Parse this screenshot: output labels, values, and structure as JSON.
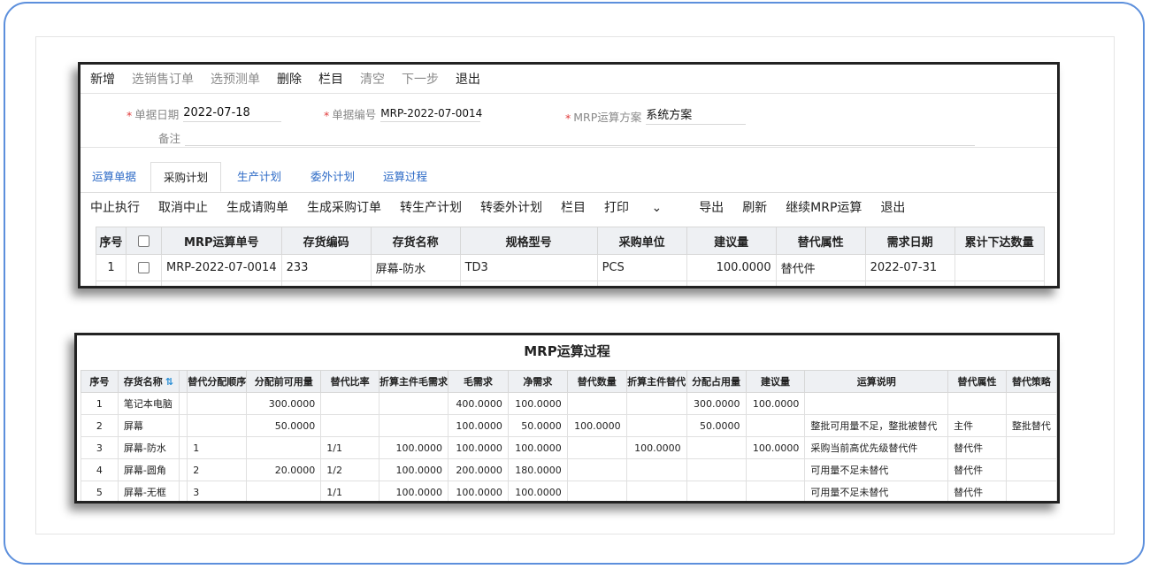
{
  "toolbar": [
    "新增",
    "选销售订单",
    "选预测单",
    "删除",
    "栏目",
    "清空",
    "下一步",
    "退出"
  ],
  "form": {
    "date_label": "单据日期",
    "date_value": "2022-07-18",
    "no_label": "单据编号",
    "no_value": "MRP-2022-07-0014",
    "plan_label": "MRP运算方案",
    "plan_value": "系统方案",
    "remark_label": "备注",
    "remark_value": ""
  },
  "tabs": [
    "运算单据",
    "采购计划",
    "生产计划",
    "委外计划",
    "运算过程"
  ],
  "toolbar2": [
    "中止执行",
    "取消中止",
    "生成请购单",
    "生成采购订单",
    "转生产计划",
    "转委外计划",
    "栏目",
    "打印",
    "导出",
    "刷新",
    "继续MRP运算",
    "退出"
  ],
  "print_caret": "⌄",
  "grid1": {
    "headers": [
      "序号",
      "",
      "MRP运算单号",
      "存货编码",
      "存货名称",
      "规格型号",
      "采购单位",
      "建议量",
      "替代属性",
      "需求日期",
      "累计下达数量"
    ],
    "rows": [
      [
        "1",
        "",
        "MRP-2022-07-0014",
        "233",
        "屏幕-防水",
        "TD3",
        "PCS",
        "100.0000",
        "替代件",
        "2022-07-31",
        ""
      ]
    ]
  },
  "panel2": {
    "title": "MRP运算过程",
    "headers": [
      "序号",
      "存货名称",
      "",
      "替代分配顺序",
      "分配前可用量",
      "替代比率",
      "折算主件毛需求",
      "毛需求",
      "净需求",
      "替代数量",
      "折算主件替代",
      "分配占用量",
      "建议量",
      "运算说明",
      "替代属性",
      "替代策略"
    ],
    "sort_icon": "⇅",
    "rows": [
      [
        "1",
        "笔记本电脑",
        "",
        "",
        "300.0000",
        "",
        "",
        "400.0000",
        "100.0000",
        "",
        "",
        "300.0000",
        "100.0000",
        "",
        "",
        ""
      ],
      [
        "2",
        "屏幕",
        "",
        "",
        "50.0000",
        "",
        "",
        "100.0000",
        "50.0000",
        "100.0000",
        "",
        "50.0000",
        "",
        "整批可用量不足，整批被替代",
        "主件",
        "整批替代"
      ],
      [
        "3",
        "屏幕-防水",
        "",
        "1",
        "",
        "1/1",
        "100.0000",
        "100.0000",
        "100.0000",
        "",
        "100.0000",
        "",
        "100.0000",
        "采购当前高优先级替代件",
        "替代件",
        ""
      ],
      [
        "4",
        "屏幕-圆角",
        "",
        "2",
        "20.0000",
        "1/2",
        "100.0000",
        "200.0000",
        "180.0000",
        "",
        "",
        "",
        "",
        "可用量不足未替代",
        "替代件",
        ""
      ],
      [
        "5",
        "屏幕-无框",
        "",
        "3",
        "",
        "1/1",
        "100.0000",
        "100.0000",
        "100.0000",
        "",
        "",
        "",
        "",
        "可用量不足未替代",
        "替代件",
        ""
      ]
    ]
  }
}
